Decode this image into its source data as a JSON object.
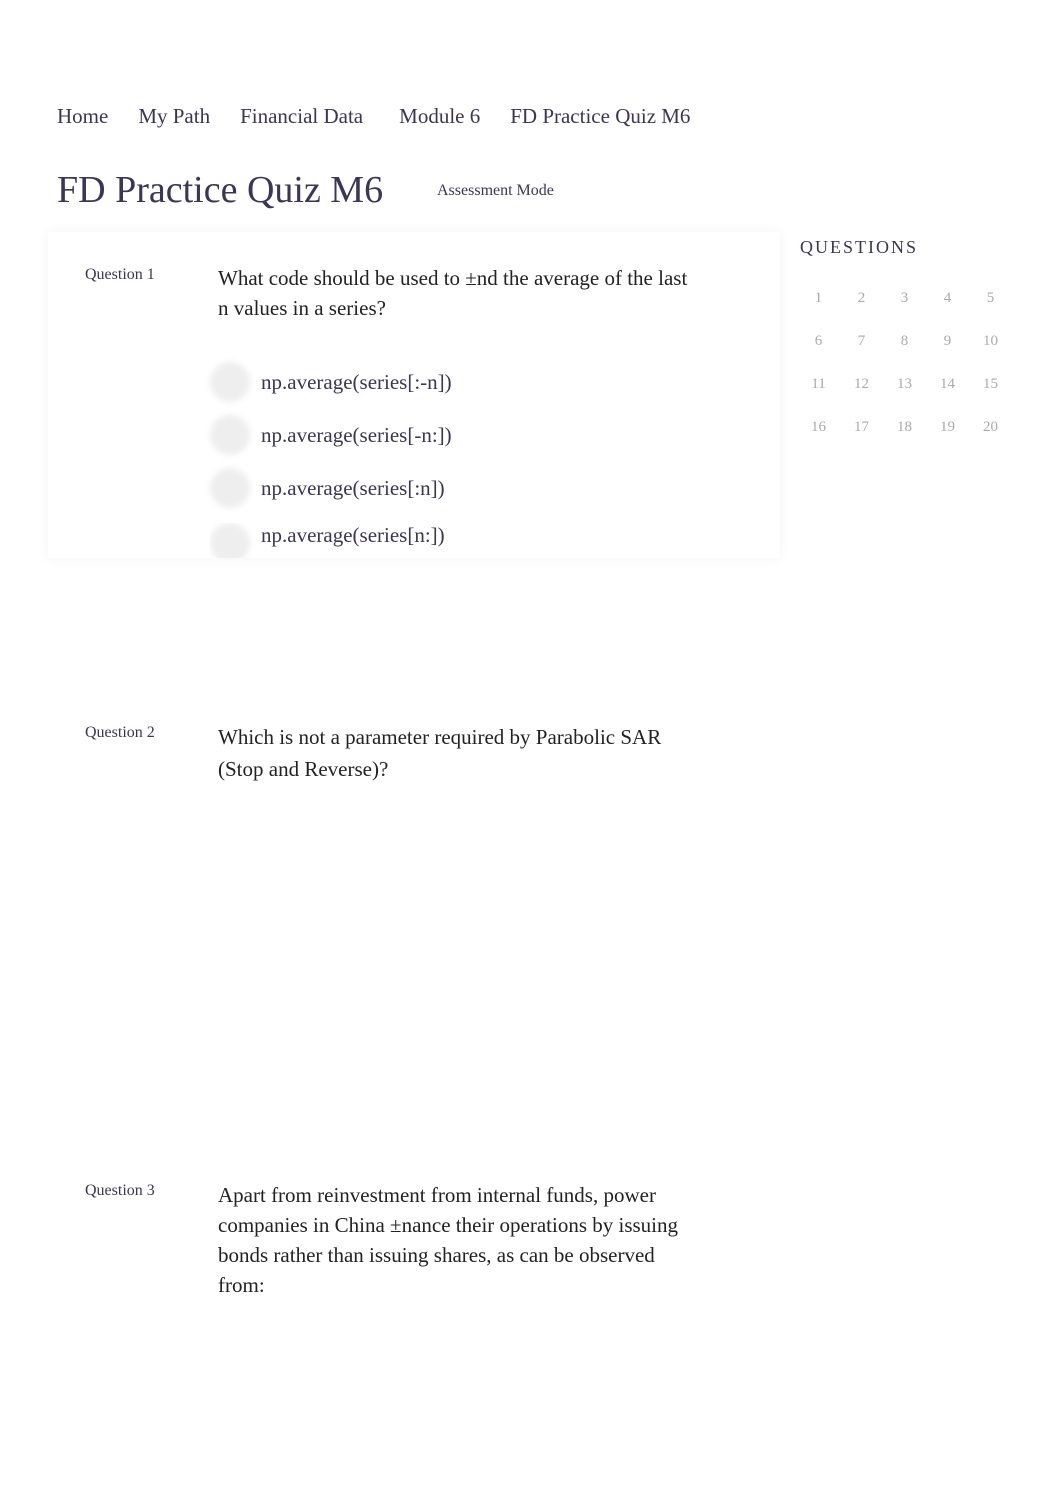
{
  "breadcrumb": [
    "Home",
    "My Path",
    "Financial Data",
    "Module 6",
    "FD Practice Quiz M6"
  ],
  "title": "FD Practice Quiz M6",
  "mode": "Assessment Mode",
  "questions_panel": {
    "heading": "QUESTIONS",
    "numbers": [
      "1",
      "2",
      "3",
      "4",
      "5",
      "6",
      "7",
      "8",
      "9",
      "10",
      "11",
      "12",
      "13",
      "14",
      "15",
      "16",
      "17",
      "18",
      "19",
      "20"
    ]
  },
  "questions": [
    {
      "label": "Question 1",
      "text": "What code should be used to ±nd the average of the last n values in a series?",
      "options": [
        "np.average(series[:-n])",
        "np.average(series[-n:])",
        "np.average(series[:n])",
        "np.average(series[n:])"
      ]
    },
    {
      "label": "Question 2",
      "text": "Which is  not  a parameter required by Parabolic SAR (Stop and Reverse)?"
    },
    {
      "label": "Question 3",
      "text": "Apart from reinvestment from internal funds, power companies in China ±nance their operations by issuing bonds rather than issuing shares, as can be observed from:"
    }
  ]
}
